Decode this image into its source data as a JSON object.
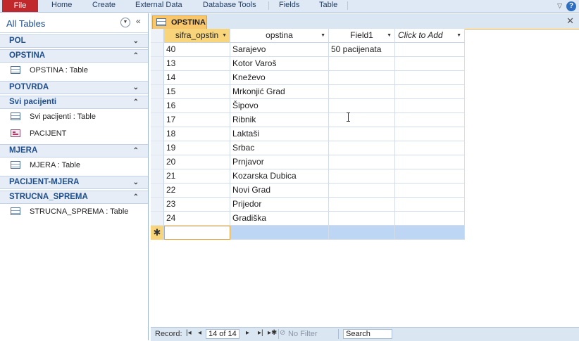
{
  "ribbon": {
    "tabs": [
      "File",
      "Home",
      "Create",
      "External Data",
      "Database Tools",
      "Fields",
      "Table"
    ]
  },
  "nav": {
    "title": "All Tables",
    "groups": [
      {
        "name": "POL",
        "chevron": "expand-icon",
        "items": []
      },
      {
        "name": "OPSTINA",
        "chevron": "collapse-icon",
        "items": [
          {
            "label": "OPSTINA : Table",
            "icon": "table-icon"
          }
        ]
      },
      {
        "name": "POTVRDA",
        "chevron": "expand-icon",
        "items": []
      },
      {
        "name": "Svi pacijenti",
        "chevron": "collapse-icon",
        "items": [
          {
            "label": "Svi pacijenti : Table",
            "icon": "table-icon"
          },
          {
            "label": "PACIJENT",
            "icon": "form-icon"
          }
        ]
      },
      {
        "name": "MJERA",
        "chevron": "collapse-icon",
        "items": [
          {
            "label": "MJERA : Table",
            "icon": "table-icon"
          }
        ]
      },
      {
        "name": "PACIJENT-MJERA",
        "chevron": "expand-icon",
        "items": []
      },
      {
        "name": "STRUCNA_SPREMA",
        "chevron": "collapse-icon",
        "items": [
          {
            "label": "STRUCNA_SPREMA : Table",
            "icon": "table-icon"
          }
        ]
      }
    ]
  },
  "doc": {
    "tab_label": "OPSTINA"
  },
  "datasheet": {
    "columns": [
      "sifra_opstin",
      "opstina",
      "Field1",
      "Click to Add"
    ],
    "rows": [
      [
        "40",
        "Sarajevo",
        "50 pacijenata"
      ],
      [
        "13",
        "Kotor Varoš",
        ""
      ],
      [
        "14",
        "Kneževo",
        ""
      ],
      [
        "15",
        "Mrkonjić Grad",
        ""
      ],
      [
        "16",
        "Šipovo",
        ""
      ],
      [
        "17",
        "Ribnik",
        ""
      ],
      [
        "18",
        "Laktaši",
        ""
      ],
      [
        "19",
        "Srbac",
        ""
      ],
      [
        "20",
        "Prnjavor",
        ""
      ],
      [
        "21",
        "Kozarska Dubica",
        ""
      ],
      [
        "22",
        "Novi Grad",
        ""
      ],
      [
        "23",
        "Prijedor",
        ""
      ],
      [
        "24",
        "Gradiška",
        ""
      ]
    ],
    "new_record_marker": "✱"
  },
  "record_bar": {
    "label": "Record:",
    "position": "14 of 14",
    "filter": "No Filter",
    "search": "Search"
  },
  "colors": {
    "file_tab": "#c0282c",
    "active_tab": "#f9c76b",
    "new_row": "#bcd6f3"
  }
}
